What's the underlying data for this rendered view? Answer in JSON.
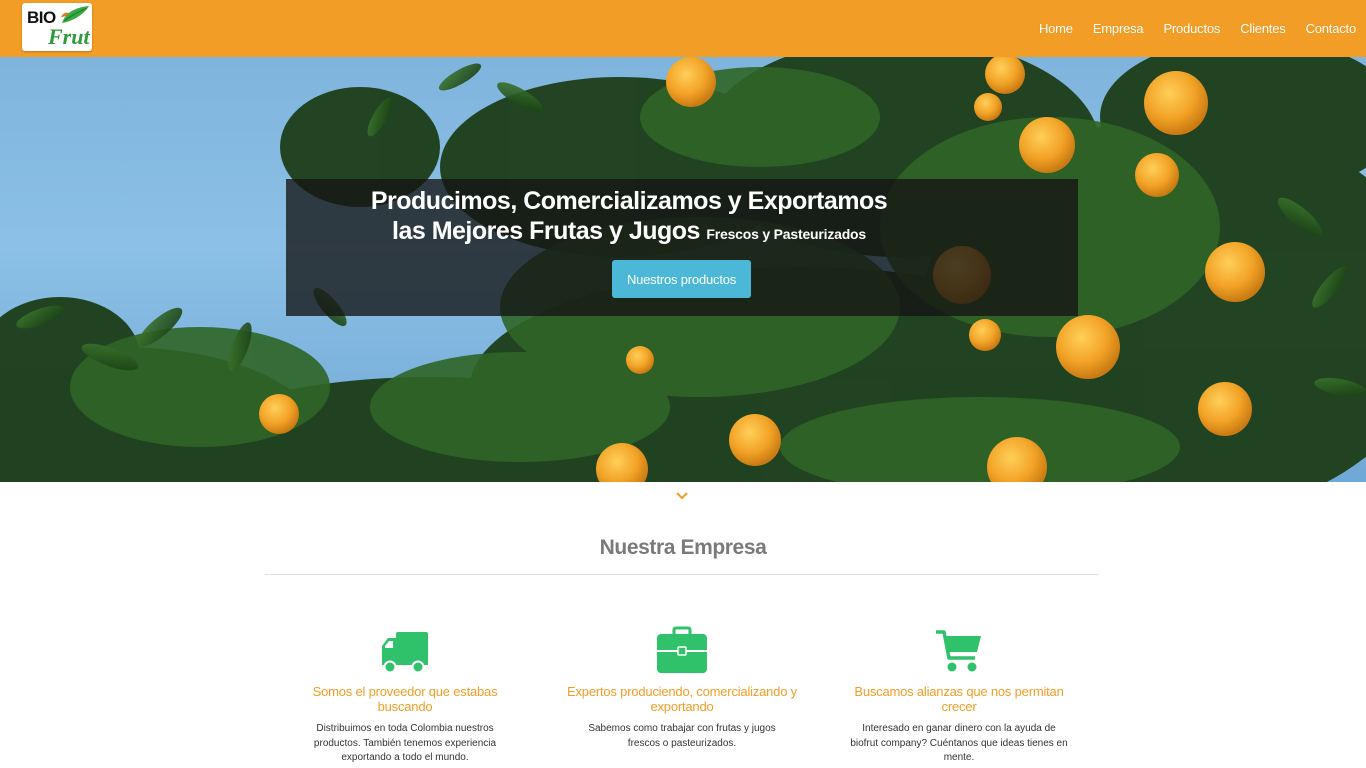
{
  "brand": {
    "logo_top": "BIO",
    "logo_bottom": "Frut",
    "accent": "#f29d25",
    "green": "#2fc26b"
  },
  "nav": {
    "items": [
      {
        "label": "Home"
      },
      {
        "label": "Empresa"
      },
      {
        "label": "Productos"
      },
      {
        "label": "Clientes"
      },
      {
        "label": "Contacto"
      }
    ]
  },
  "hero": {
    "line1": "Producimos, Comercializamos y Exportamos",
    "line2_main": "las Mejores Frutas y Jugos",
    "line2_small": "Frescos y Pasteurizados",
    "button": "Nuestros productos"
  },
  "section": {
    "scroll_icon": "chevron-down-icon",
    "title": "Nuestra Empresa",
    "features": [
      {
        "icon": "truck-icon",
        "title": "Somos el proveedor que estabas buscando",
        "text": "Distribuimos en toda Colombia nuestros productos. También tenemos experiencia exportando a todo el mundo."
      },
      {
        "icon": "briefcase-icon",
        "title": "Expertos produciendo, comercializando y exportando",
        "text": "Sabemos como trabajar con frutas y jugos frescos o pasteurizados."
      },
      {
        "icon": "shopping-cart-icon",
        "title": "Buscamos alianzas que nos permitan crecer",
        "text": "Interesado en ganar dinero con la ayuda de biofrut company? Cuéntanos que ideas tienes en mente."
      }
    ]
  }
}
